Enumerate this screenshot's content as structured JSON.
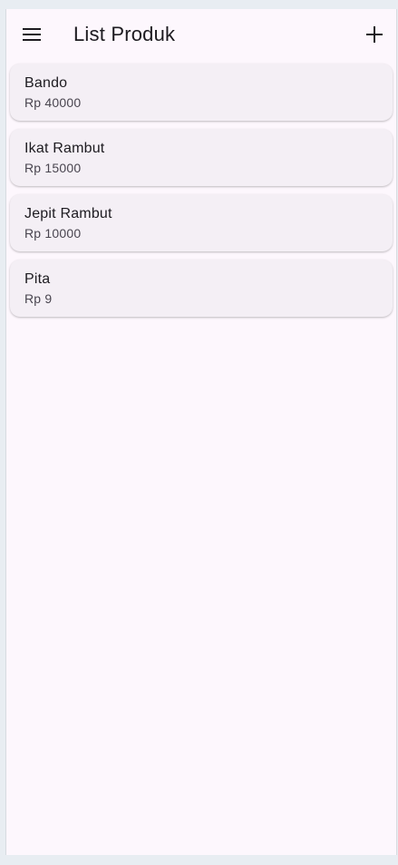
{
  "appbar": {
    "title": "List Produk",
    "menu_icon": "menu-icon",
    "add_icon": "add-icon"
  },
  "products": [
    {
      "name": "Bando",
      "price": "Rp 40000"
    },
    {
      "name": "Ikat Rambut",
      "price": "Rp 15000"
    },
    {
      "name": "Jepit Rambut",
      "price": "Rp 10000"
    },
    {
      "name": "Pita",
      "price": "Rp 9"
    }
  ],
  "colors": {
    "background": "#fdf7fd",
    "card": "#f4eff5",
    "text_primary": "#1d1b20",
    "text_secondary": "#49454f"
  }
}
